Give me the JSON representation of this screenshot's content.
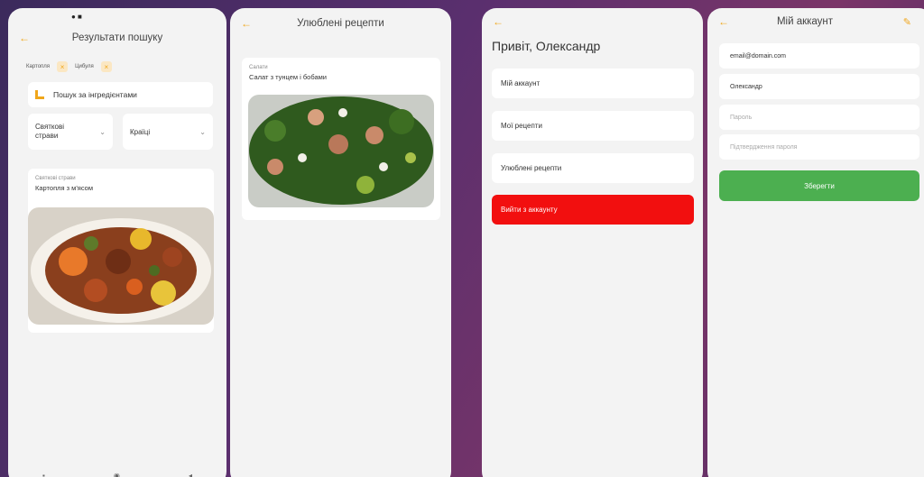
{
  "search_screen": {
    "title": "Результати пошуку",
    "back_icon": "arrow-left-icon",
    "filters": [
      {
        "label": "Картопля"
      },
      {
        "label": "Цибуля"
      }
    ],
    "ingredient_search_label": "Пошук за інгредієнтами",
    "select_category": "Святкові страви",
    "select_country": "Країці",
    "recipe": {
      "category": "Святкові страви",
      "name": "Картопля з м'ясом"
    }
  },
  "favorites_screen": {
    "title": "Улюблені рецепти",
    "recipe": {
      "category": "Салати",
      "name": "Салат з тунцем і бобами"
    }
  },
  "profile_screen": {
    "greeting": "Привіт, Олександр",
    "items": [
      "Мій аккаунт",
      "Мої рецепти",
      "Улюблені рецепти"
    ],
    "logout": "Вийти з аккаунту"
  },
  "account_screen": {
    "title": "Мій аккаунт",
    "email": "email@domain.com",
    "name": "Олександр",
    "password_placeholder": "Пароль",
    "confirm_placeholder": "Підтвердження пароля",
    "save": "Зберегти"
  },
  "colors": {
    "accent": "#f0a61b",
    "danger": "#f20f0f",
    "success": "#4caf50"
  }
}
